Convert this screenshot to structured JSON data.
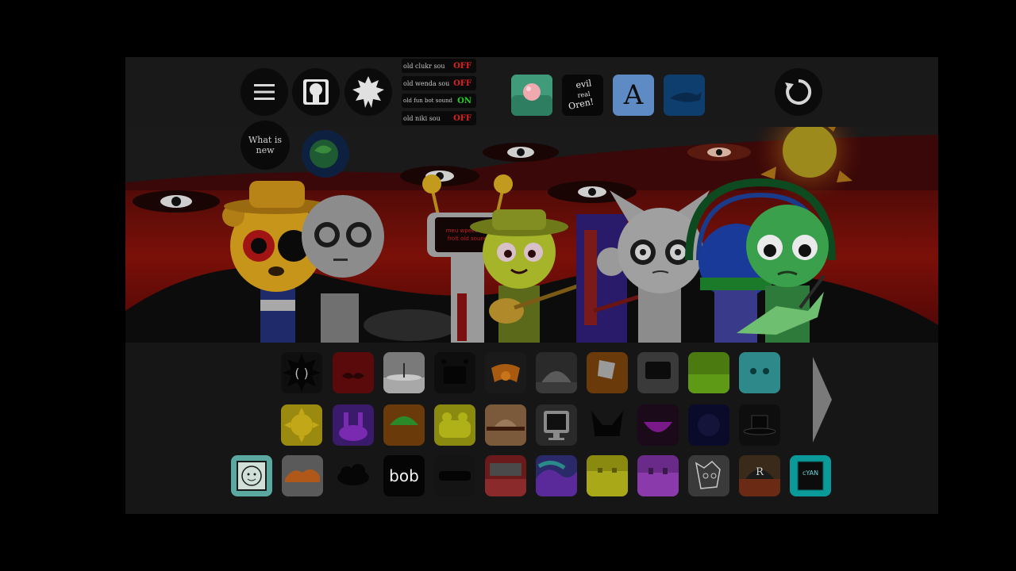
{
  "top_bar": {
    "menu_icon": "hamburger-menu-icon",
    "profile_icon": "character-profile-icon",
    "settings_icon": "star-burst-icon",
    "reset_icon": "circular-reset-icon",
    "what_is_new": "What is new"
  },
  "sound_toggles": [
    {
      "label": "old clukr sou",
      "state": "OFF",
      "state_color": "#e02020"
    },
    {
      "label": "old wenda sou",
      "state": "OFF",
      "state_color": "#e02020"
    },
    {
      "label": "old fun bot sound",
      "state": "ON",
      "state_color": "#22d022"
    },
    {
      "label": "old niki sou",
      "state": "OFF",
      "state_color": "#e02020"
    }
  ],
  "mod_buttons": [
    {
      "name": "pink-orb-mod",
      "color": "#4fae8a"
    },
    {
      "name": "evil-oren-mod",
      "text": "evil\nreal\nOren!"
    },
    {
      "name": "letter-a-mod",
      "text": "A",
      "color": "#5e8bc4"
    },
    {
      "name": "blue-shark-mod",
      "color": "#0e3e6e"
    }
  ],
  "scene": {
    "screen_text_line1": "meu wpeet uvu",
    "screen_text_line2": "frolt old sound"
  },
  "tray": {
    "next_icon": "next-page-arrow-icon",
    "bob_label": "bob",
    "poster_text": "R",
    "cyan_card_text": "cYAN"
  }
}
